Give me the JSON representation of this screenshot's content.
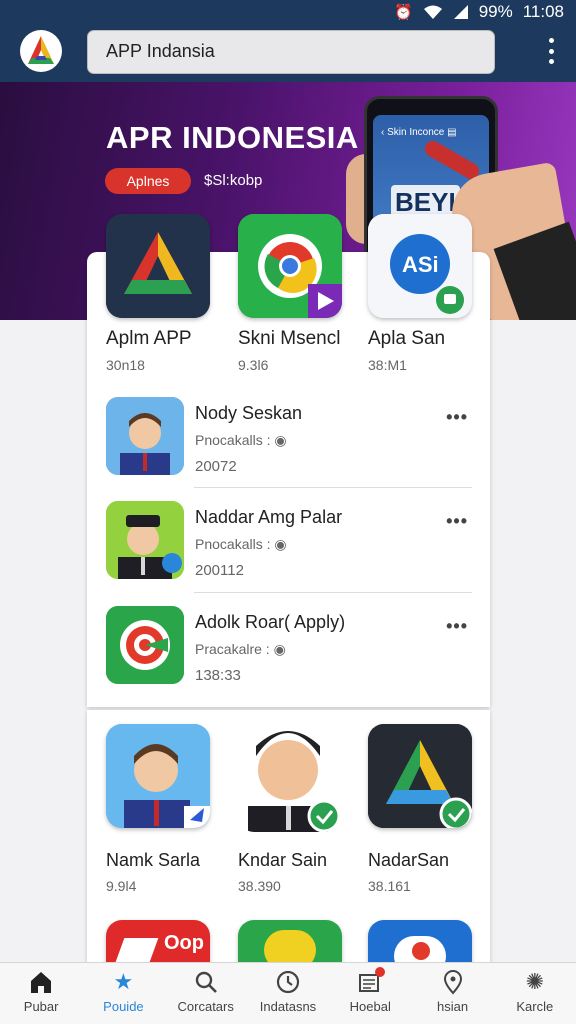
{
  "status": {
    "battery": "99%",
    "time": "11:08"
  },
  "search": {
    "value": "APP Indansia"
  },
  "banner": {
    "title": "APR INDONESIA",
    "pill": "Aplnes",
    "sub": "$Sl:kobp",
    "phone_header": "Skin Inconce",
    "phone_logo": "BEYI"
  },
  "featured": [
    {
      "name": "Aplm APP",
      "meta": "30n18"
    },
    {
      "name": "Skni Msencl",
      "meta": "9.3l6"
    },
    {
      "name": "Apla San",
      "meta": "38:M1"
    }
  ],
  "list": [
    {
      "name": "Nody Seskan",
      "sub": "Pnocakalls :",
      "num": "20072"
    },
    {
      "name": "Naddar Amg Palar",
      "sub": "Pnocakalls :",
      "num": "200112"
    },
    {
      "name": "Adolk Roar( Apply)",
      "sub": "Pracakalre :",
      "num": "138:33"
    }
  ],
  "grid": [
    {
      "name": "Namk Sarla",
      "meta": "9.9l4"
    },
    {
      "name": "Kndar Sain",
      "meta": "38.390"
    },
    {
      "name": "NadarSan",
      "meta": "38.161"
    }
  ],
  "grid_bottom": {
    "first_label": "Oop"
  },
  "nav": [
    {
      "label": "Pubar",
      "icon": "home-icon"
    },
    {
      "label": "Pouide",
      "icon": "star-icon"
    },
    {
      "label": "Corcatars",
      "icon": "search-icon"
    },
    {
      "label": "Indatasns",
      "icon": "clock-icon"
    },
    {
      "label": "Hoebal",
      "icon": "news-icon"
    },
    {
      "label": "hsian",
      "icon": "location-icon"
    },
    {
      "label": "Karcle",
      "icon": "settings-icon"
    }
  ],
  "colors": {
    "top_bar": "#1d3a5e",
    "accent": "#2a86d8",
    "pill": "#d8342c"
  }
}
